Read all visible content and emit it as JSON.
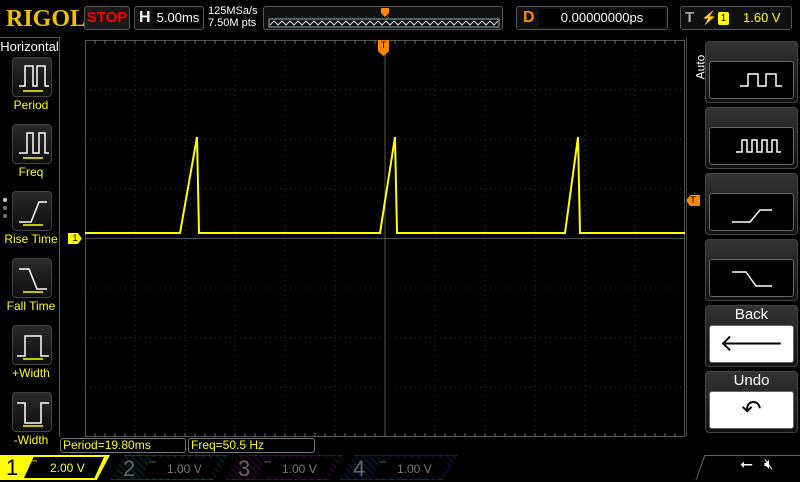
{
  "header": {
    "logo": "RIGOL",
    "run_state": "STOP",
    "timebase_label": "H",
    "timebase": "5.00ms",
    "sample_rate": "125MSa/s",
    "memory_depth": "7.50M pts",
    "delay_label": "D",
    "delay": "0.00000000ps",
    "trigger_label": "T",
    "trigger_channel": "1",
    "trigger_level": "1.60 V"
  },
  "left_menu": {
    "title": "Horizontal",
    "items": [
      {
        "label": "Period",
        "icon": "period-icon"
      },
      {
        "label": "Freq",
        "icon": "freq-icon"
      },
      {
        "label": "Rise Time",
        "icon": "rise-time-icon"
      },
      {
        "label": "Fall Time",
        "icon": "fall-time-icon"
      },
      {
        "label": "+Width",
        "icon": "positive-width-icon"
      },
      {
        "label": "-Width",
        "icon": "negative-width-icon"
      }
    ]
  },
  "right_menu": {
    "title": "Auto",
    "items": [
      {
        "label": "",
        "icon": "square-wave-icon"
      },
      {
        "label": "",
        "icon": "fast-square-wave-icon"
      },
      {
        "label": "",
        "icon": "rising-edge-icon"
      },
      {
        "label": "",
        "icon": "falling-edge-icon"
      },
      {
        "label": "Back",
        "icon": "back-arrow-icon"
      },
      {
        "label": "Undo",
        "icon": "undo-icon"
      }
    ]
  },
  "measurements": [
    "Period=19.80ms",
    "Freq=50.5 Hz"
  ],
  "channels": [
    {
      "num": "1",
      "scale": "2.00 V",
      "color": "#ffff00",
      "active": true
    },
    {
      "num": "2",
      "scale": "1.00 V",
      "color": "#00a0a0"
    },
    {
      "num": "3",
      "scale": "1.00 V",
      "color": "#c000c0"
    },
    {
      "num": "4",
      "scale": "1.00 V",
      "color": "#0060ff"
    }
  ],
  "colors": {
    "ch1": "#ffff00",
    "trigger": "#ff8800"
  }
}
